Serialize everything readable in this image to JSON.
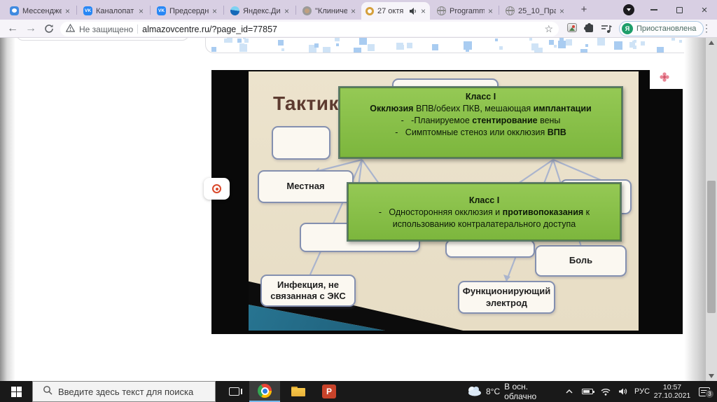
{
  "icons": {
    "close_x": "×",
    "plus": "+",
    "back": "←",
    "forward": "→",
    "star": "☆",
    "menu_dots": "⋮",
    "vk": "VK"
  },
  "browser": {
    "tabs": [
      {
        "title": "Мессендже"
      },
      {
        "title": "Каналопат"
      },
      {
        "title": "Предсердн"
      },
      {
        "title": "Яндекс.Дис"
      },
      {
        "title": "\"Клиничес"
      },
      {
        "title": "27 октя"
      },
      {
        "title": "Programm_"
      },
      {
        "title": "25_10_Пра"
      }
    ],
    "address": {
      "security": "Не защищено",
      "url": "almazovcentre.ru/?page_id=77857"
    },
    "profile": {
      "avatar": "Я",
      "status": "Приостановлена"
    }
  },
  "slide": {
    "title": "Тактика",
    "green_box_1": {
      "heading": "Класс I",
      "lines": [
        [
          {
            "t": "Окклюзия",
            "b": true
          },
          {
            "t": " ВПВ/обеих ПКВ, мешающая "
          },
          {
            "t": "имплантации",
            "b": true
          }
        ],
        [
          {
            "t": "-   -Планируемое "
          },
          {
            "t": "стентирование",
            "b": true
          },
          {
            "t": " вены"
          }
        ],
        [
          {
            "t": "-   Симптомные стеноз или окклюзия "
          },
          {
            "t": "ВПВ",
            "b": true
          }
        ]
      ]
    },
    "green_box_2": {
      "heading": "Класс I",
      "lines": [
        [
          {
            "t": "-   Односторонняя окклюзия и "
          },
          {
            "t": "противопоказания",
            "b": true
          },
          {
            "t": " к"
          }
        ],
        [
          {
            "t": "использованию контралатерального доступа"
          }
        ]
      ]
    },
    "nodes": {
      "local": "Местная",
      "pain": "Боль",
      "infection": "Инфекция, не связанная с ЭКС",
      "electrode": "Функционирующий электрод"
    }
  },
  "taskbar": {
    "search_placeholder": "Введите здесь текст для поиска",
    "weather_temp": "8°С",
    "weather_condition": "В осн. облачно",
    "language": "РУС",
    "time": "10:57",
    "date": "27.10.2021",
    "notification_count": "3",
    "powerpoint_letter": "P"
  }
}
